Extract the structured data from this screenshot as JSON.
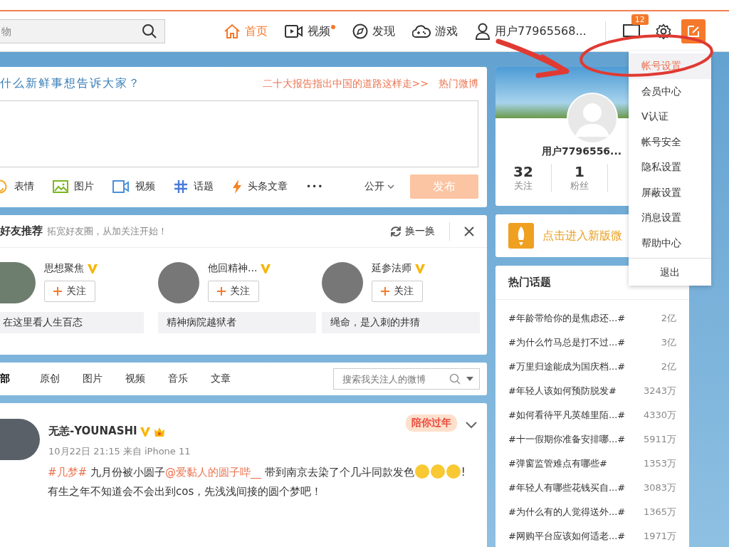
{
  "nav": {
    "search": {
      "placeholder": "物"
    },
    "items": [
      {
        "kind": "home",
        "label": "首页",
        "selected": true,
        "dot": false
      },
      {
        "kind": "video",
        "label": "视频",
        "selected": false,
        "dot": true
      },
      {
        "kind": "discover",
        "label": "发现",
        "selected": false,
        "dot": false
      },
      {
        "kind": "game",
        "label": "游戏",
        "selected": false,
        "dot": false
      },
      {
        "kind": "user",
        "label": "用户77965568...",
        "selected": false,
        "dot": false
      }
    ],
    "message_badge": "12"
  },
  "composer": {
    "prompt": "什么新鲜事想告诉大家？",
    "trending_link": "二十大报告指出中国的道路这样走>>",
    "hot_link": "热门微博",
    "tools": [
      {
        "kind": "emoji",
        "label": "表情"
      },
      {
        "kind": "image",
        "label": "图片"
      },
      {
        "kind": "video",
        "label": "视频"
      },
      {
        "kind": "topic",
        "label": "话题"
      },
      {
        "kind": "article",
        "label": "头条文章"
      },
      {
        "kind": "more",
        "label": "•••"
      }
    ],
    "visibility": "公开",
    "submit": "发布",
    "submit_disabled": true
  },
  "friends": {
    "title": "好友推荐",
    "subtitle": "拓宽好友圈，从加关注开始！",
    "refresh": "换一换",
    "people": [
      {
        "name": "思想聚焦",
        "verified": true,
        "follow": "关注",
        "bio": "在这里看人生百态"
      },
      {
        "name": "他回精神...",
        "verified": true,
        "follow": "关注",
        "bio": "精神病院越狱者"
      },
      {
        "name": "延参法师",
        "verified": true,
        "follow": "关注",
        "bio": "绳命，是入刺的井猜"
      }
    ]
  },
  "feed_tabs": {
    "tabs": [
      {
        "label": "部",
        "selected": true
      },
      {
        "label": "原创",
        "selected": false
      },
      {
        "label": "图片",
        "selected": false
      },
      {
        "label": "视频",
        "selected": false
      },
      {
        "label": "音乐",
        "selected": false
      },
      {
        "label": "文章",
        "selected": false
      }
    ],
    "search": {
      "placeholder": "搜索我关注人的微博"
    }
  },
  "post": {
    "author": "无恙-YOUNASHI",
    "verified": true,
    "sticker": "陪你过年",
    "meta": "10月22日 21:15 来自 iPhone 11",
    "segments": [
      {
        "kind": "link",
        "text": "#几梦#"
      },
      {
        "kind": "text",
        "text": " 九月份被小圆子"
      },
      {
        "kind": "link",
        "text": "@爱黏人的圆子哔__"
      },
      {
        "kind": "text",
        "text": " 带到南京去染了个几斗同款发色"
      },
      {
        "kind": "emoji"
      },
      {
        "kind": "emoji"
      },
      {
        "kind": "emoji"
      },
      {
        "kind": "text",
        "text": "!"
      },
      {
        "kind": "break"
      },
      {
        "kind": "text",
        "text": "有生之年不知道会不会出到cos，先浅浅间接的圆个梦吧！"
      }
    ]
  },
  "profile": {
    "name": "用户7796556...",
    "stats": [
      {
        "value": "32",
        "label": "关注"
      },
      {
        "value": "1",
        "label": "粉丝"
      }
    ]
  },
  "new_version": {
    "label": "点击进入新版微"
  },
  "hot_topics": {
    "title": "热门话题",
    "items": [
      {
        "topic": "#年龄带给你的是焦虑还...#",
        "count": "2亿"
      },
      {
        "topic": "#为什么竹马总是打不过...#",
        "count": "3亿"
      },
      {
        "topic": "#万里归途能成为国庆档...#",
        "count": "2亿"
      },
      {
        "topic": "#年轻人该如何预防脱发#",
        "count": "3243万"
      },
      {
        "topic": "#如何看待平凡英雄里陌...#",
        "count": "4330万"
      },
      {
        "topic": "#十一假期你准备安排哪...#",
        "count": "5911万"
      },
      {
        "topic": "#弹窗监管难点有哪些#",
        "count": "1353万"
      },
      {
        "topic": "#年轻人有哪些花钱买自...#",
        "count": "3083万"
      },
      {
        "topic": "#为什么有的人觉得送外...#",
        "count": "1365万"
      },
      {
        "topic": "#网购平台应该如何适老...#",
        "count": "1971万"
      }
    ]
  },
  "account_menu": {
    "items": [
      {
        "label": "帐号设置",
        "selected": true
      },
      {
        "label": "会员中心",
        "selected": false
      },
      {
        "label": "V认证",
        "selected": false
      },
      {
        "label": "帐号安全",
        "selected": false
      },
      {
        "label": "隐私设置",
        "selected": false
      },
      {
        "label": "屏蔽设置",
        "selected": false
      },
      {
        "label": "消息设置",
        "selected": false
      },
      {
        "label": "帮助中心",
        "selected": false
      }
    ],
    "logout": "退出"
  }
}
